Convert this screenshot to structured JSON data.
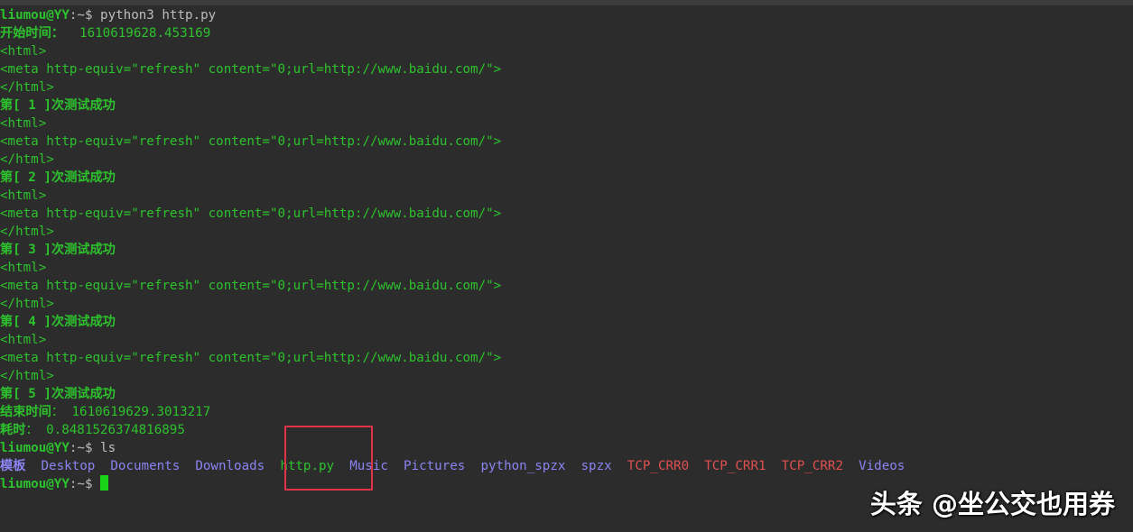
{
  "prompt": {
    "user": "liumou@YY",
    "sep": ":~$ "
  },
  "cmd1": "python3 http.py",
  "start": {
    "label": "开始时间：",
    "value": "  1610619628.453169"
  },
  "html": {
    "open": "<html>",
    "meta": "<meta http-equiv=\"refresh\" content=\"0;url=http://www.baidu.com/\">",
    "close": "</html>"
  },
  "results": [
    "第[ 1 ]次测试成功",
    "第[ 2 ]次测试成功",
    "第[ 3 ]次测试成功",
    "第[ 4 ]次测试成功",
    "第[ 5 ]次测试成功"
  ],
  "end": {
    "label": "结束时间",
    "value": "： 1610619629.3013217"
  },
  "elapsed": {
    "label": "耗时",
    "value": "： 0.8481526374816895"
  },
  "cmd2": "ls",
  "ls": {
    "items": [
      {
        "name": "模板",
        "kind": "tmpl"
      },
      {
        "name": "Desktop",
        "kind": "dir"
      },
      {
        "name": "Documents",
        "kind": "dir"
      },
      {
        "name": "Downloads",
        "kind": "dir"
      },
      {
        "name": "http.py",
        "kind": "exe"
      },
      {
        "name": "Music",
        "kind": "dir"
      },
      {
        "name": "Pictures",
        "kind": "dir"
      },
      {
        "name": "python_spzx",
        "kind": "dir"
      },
      {
        "name": "spzx",
        "kind": "dir"
      },
      {
        "name": "TCP_CRR0",
        "kind": "red"
      },
      {
        "name": "TCP_CRR1",
        "kind": "red"
      },
      {
        "name": "TCP_CRR2",
        "kind": "red"
      },
      {
        "name": "Videos",
        "kind": "dir"
      }
    ]
  },
  "watermark": "头条 @坐公交也用券",
  "colors": {
    "background": "#2c2c2c",
    "green": "#2dc22d",
    "directory": "#8b83f2",
    "red": "#e05050",
    "highlight_box": "#e0344a"
  }
}
